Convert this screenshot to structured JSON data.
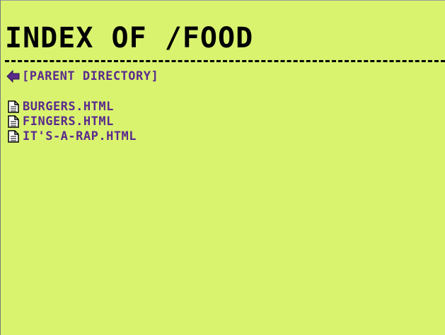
{
  "page": {
    "title": "INDEX OF /FOOD"
  },
  "parent_directory": {
    "label": "[PARENT DIRECTORY]",
    "icon": "back-arrow-icon"
  },
  "files": [
    {
      "name": "BURGERS.HTML",
      "icon": "file-icon"
    },
    {
      "name": "FINGERS.HTML",
      "icon": "file-icon"
    },
    {
      "name": "IT'S-A-RAP.HTML",
      "icon": "file-icon"
    }
  ],
  "colors": {
    "background": "#d9f36f",
    "title": "#000000",
    "link": "#5a2a8c"
  }
}
